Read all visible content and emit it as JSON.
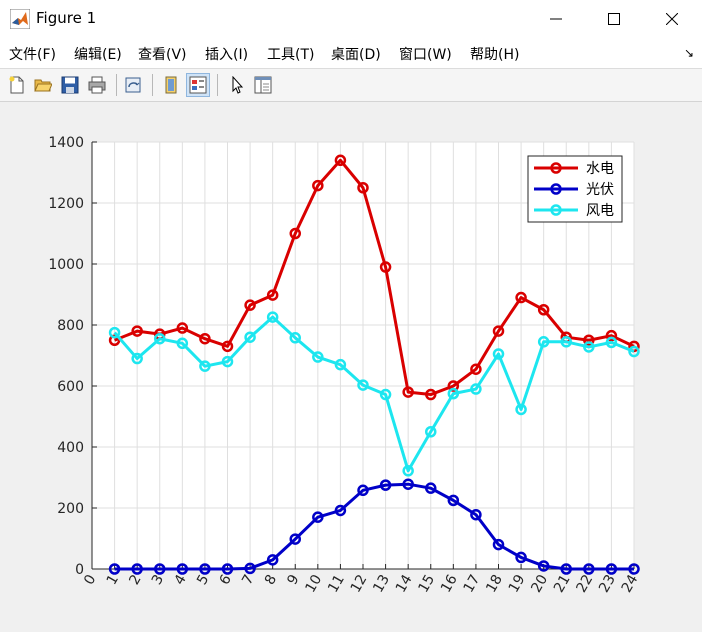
{
  "window": {
    "title": "Figure 1",
    "icon": "matlab-icon"
  },
  "menu": {
    "items": [
      "文件(F)",
      "编辑(E)",
      "查看(V)",
      "插入(I)",
      "工具(T)",
      "桌面(D)",
      "窗口(W)",
      "帮助(H)"
    ],
    "overflow_icon": "dock-arrow-icon"
  },
  "toolbar": {
    "buttons": [
      "new-figure-icon",
      "open-file-icon",
      "save-figure-icon",
      "print-figure-icon",
      "link-plot-icon",
      "hide-plot-tools-icon",
      "show-plot-tools-icon",
      "edit-plot-icon",
      "property-inspector-icon"
    ]
  },
  "chart_data": {
    "type": "line",
    "x": [
      1,
      2,
      3,
      4,
      5,
      6,
      7,
      8,
      9,
      10,
      11,
      12,
      13,
      14,
      15,
      16,
      17,
      18,
      19,
      20,
      21,
      22,
      23,
      24
    ],
    "xticks": [
      "0",
      "1",
      "2",
      "3",
      "4",
      "5",
      "6",
      "7",
      "8",
      "9",
      "10",
      "11",
      "12",
      "13",
      "14",
      "15",
      "16",
      "17",
      "18",
      "19",
      "20",
      "21",
      "22",
      "23",
      "24"
    ],
    "xlim": [
      0,
      24
    ],
    "ylim": [
      0,
      1400
    ],
    "yticks": [
      "0",
      "200",
      "400",
      "600",
      "800",
      "1000",
      "1200",
      "1400"
    ],
    "grid": true,
    "legend_position": "top-right",
    "series": [
      {
        "name": "水电",
        "color": "#d90000",
        "values": [
          750,
          780,
          770,
          790,
          755,
          730,
          865,
          898,
          1100,
          1257,
          1340,
          1250,
          990,
          580,
          572,
          600,
          655,
          780,
          890,
          850,
          760,
          750,
          765,
          730
        ]
      },
      {
        "name": "光伏",
        "color": "#0000c8",
        "values": [
          0,
          0,
          0,
          0,
          0,
          0,
          2,
          30,
          98,
          170,
          192,
          258,
          275,
          278,
          265,
          225,
          178,
          80,
          38,
          10,
          0,
          0,
          0,
          0
        ]
      },
      {
        "name": "风电",
        "color": "#1de6ef",
        "values": [
          775,
          690,
          755,
          740,
          665,
          680,
          760,
          826,
          758,
          695,
          670,
          603,
          572,
          322,
          450,
          575,
          590,
          705,
          523,
          745,
          745,
          728,
          743,
          713
        ]
      }
    ]
  }
}
